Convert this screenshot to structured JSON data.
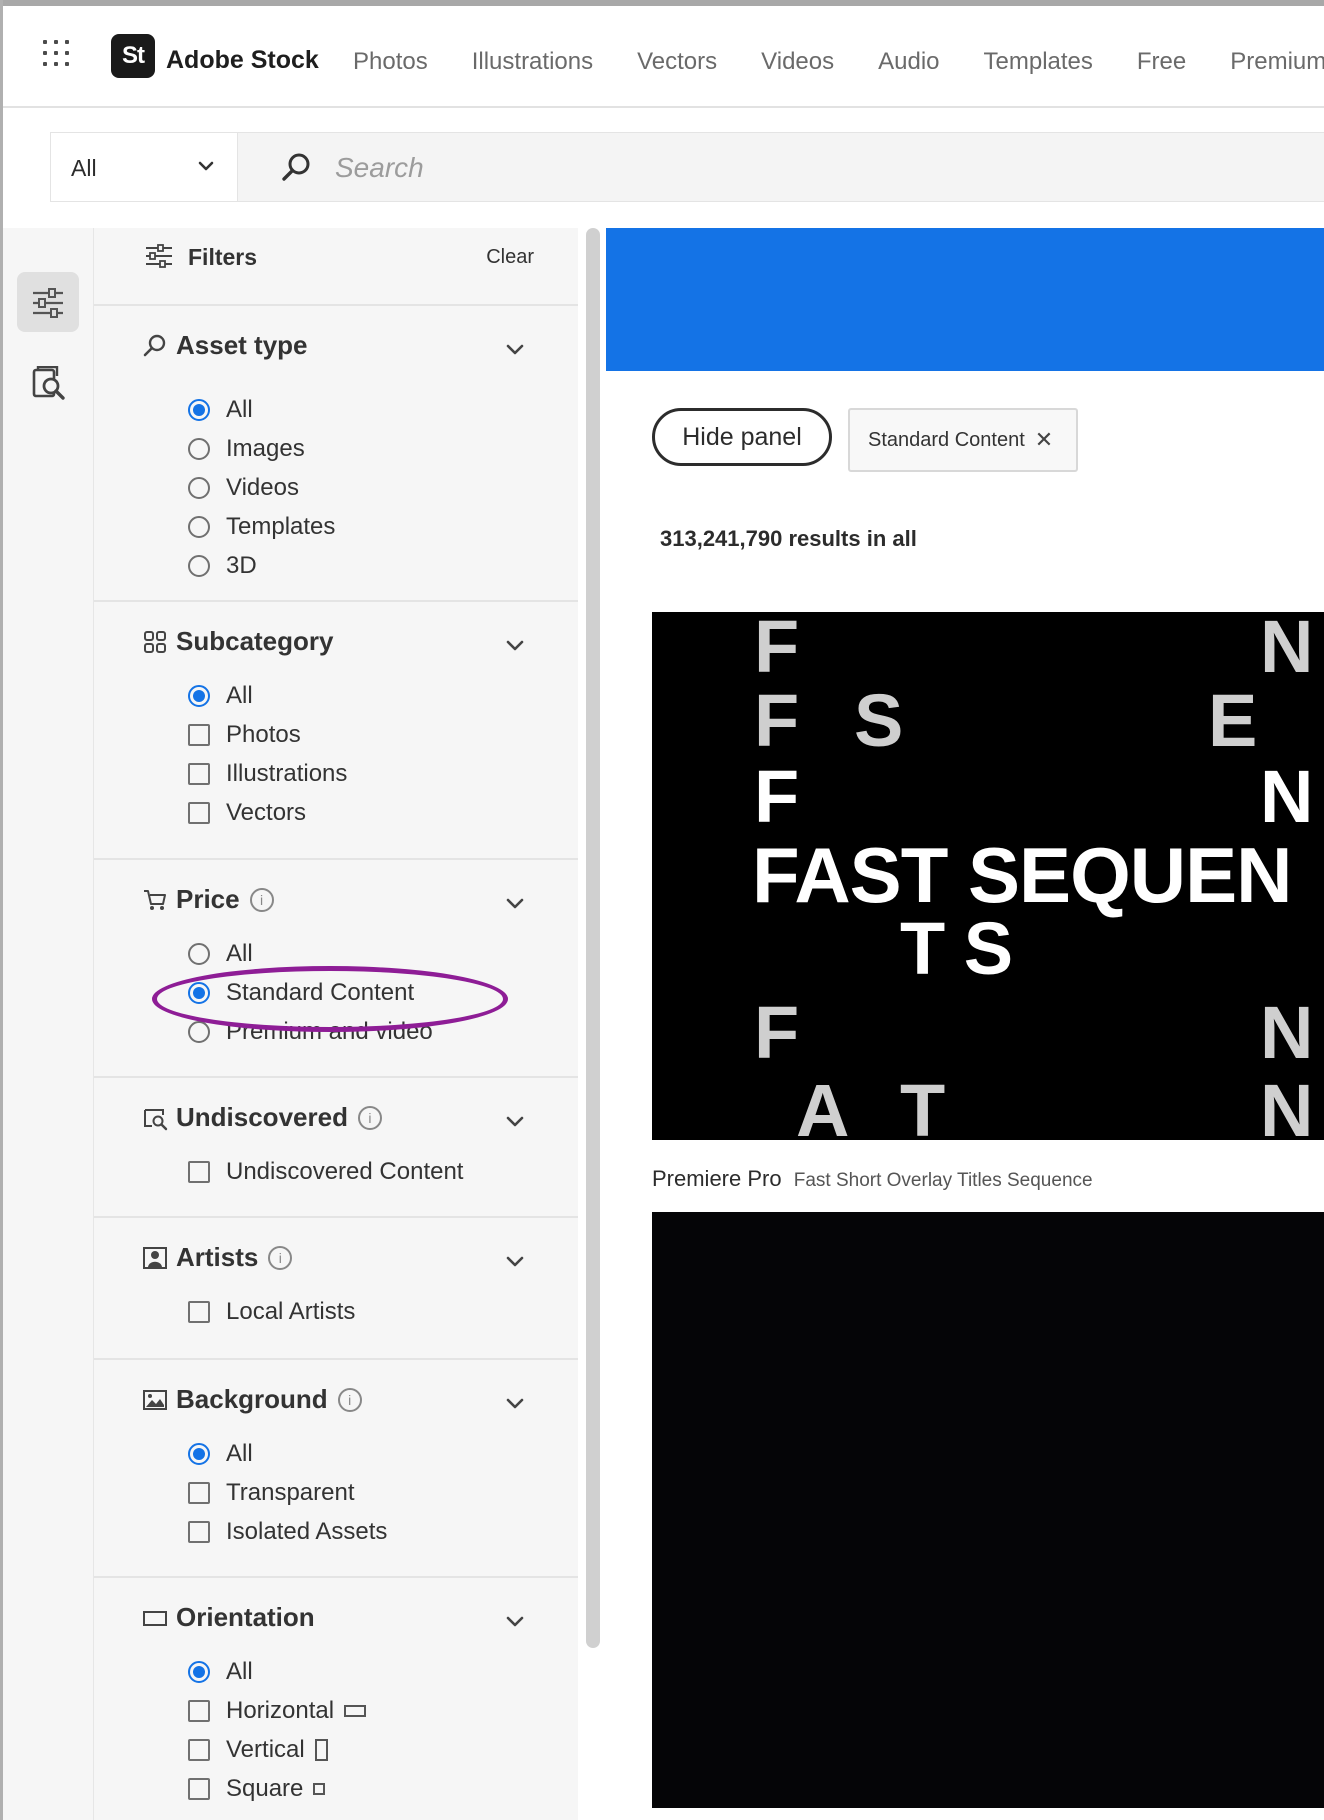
{
  "header": {
    "brand_mark": "St",
    "brand_name": "Adobe Stock",
    "nav": [
      "Photos",
      "Illustrations",
      "Vectors",
      "Videos",
      "Audio",
      "Templates",
      "Free",
      "Premium"
    ]
  },
  "search": {
    "scope": "All",
    "placeholder": "Search"
  },
  "filters": {
    "title": "Filters",
    "clear_label": "Clear",
    "asset_type": {
      "title": "Asset type",
      "options": [
        "All",
        "Images",
        "Videos",
        "Templates",
        "3D"
      ],
      "selected": "All"
    },
    "subcategory": {
      "title": "Subcategory",
      "options": [
        "All",
        "Photos",
        "Illustrations",
        "Vectors"
      ],
      "selected": "All"
    },
    "price": {
      "title": "Price",
      "options": [
        "All",
        "Standard Content",
        "Premium and video"
      ],
      "selected": "Standard Content"
    },
    "undiscovered": {
      "title": "Undiscovered",
      "options": [
        "Undiscovered Content"
      ]
    },
    "artists": {
      "title": "Artists",
      "options": [
        "Local Artists"
      ]
    },
    "background": {
      "title": "Background",
      "options": [
        "All",
        "Transparent",
        "Isolated Assets"
      ],
      "selected": "All"
    },
    "orientation": {
      "title": "Orientation",
      "options": [
        "All",
        "Horizontal",
        "Vertical",
        "Square"
      ],
      "selected": "All"
    }
  },
  "main": {
    "hide_panel_label": "Hide panel",
    "active_chip": "Standard Content",
    "results_text": "313,241,790 results in all",
    "thumb1_text": {
      "r1a": "F",
      "r1b": "N",
      "r2a": "F",
      "r2b": "S",
      "r2c": "E",
      "r3a": "F",
      "r3b": "N",
      "r4": "FAST SEQUEN",
      "r5": "T S",
      "r6a": "F",
      "r6b": "N",
      "r7a": "A",
      "r7b": "T",
      "r7c": "N"
    },
    "item1_app": "Premiere Pro",
    "item1_title": "Fast Short Overlay Titles Sequence"
  },
  "colors": {
    "accent_blue": "#1473e6",
    "annotation_purple": "#8e1d96"
  }
}
